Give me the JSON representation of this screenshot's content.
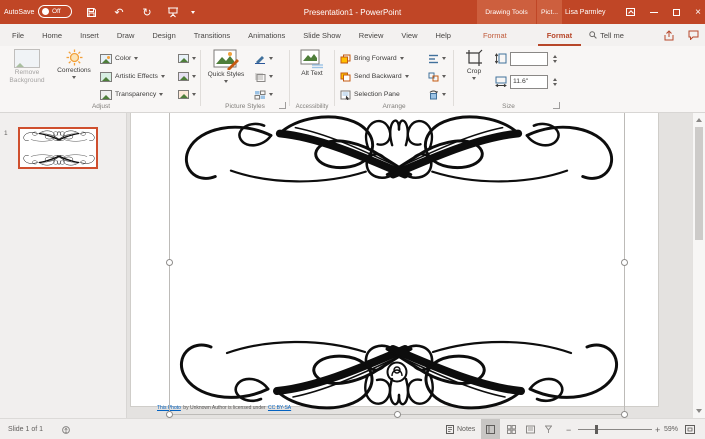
{
  "titlebar": {
    "autosave_label": "AutoSave",
    "autosave_state": "Off",
    "title": "Presentation1 - PowerPoint",
    "contextual_tool_1": "Drawing Tools",
    "contextual_tool_2": "Pict...",
    "user_name": "Lisa Parmley"
  },
  "icons": {
    "undo": "↶",
    "redo": "↻",
    "close": "×",
    "minus": "−",
    "plus": "+"
  },
  "tabs": {
    "items": [
      "File",
      "Home",
      "Insert",
      "Draw",
      "Design",
      "Transitions",
      "Animations",
      "Slide Show",
      "Review",
      "View",
      "Help"
    ],
    "format_drawing": "Format",
    "format_picture": "Format",
    "tell_me": "Tell me"
  },
  "ribbon": {
    "adjust": {
      "label": "Adjust",
      "remove_background": "Remove Background",
      "corrections": "Corrections",
      "color": "Color",
      "artistic_effects": "Artistic Effects",
      "transparency": "Transparency"
    },
    "picture_styles": {
      "label": "Picture Styles",
      "quick_styles": "Quick Styles"
    },
    "accessibility": {
      "label": "Accessibility",
      "alt_text": "Alt Text"
    },
    "arrange": {
      "label": "Arrange",
      "bring_forward": "Bring Forward",
      "send_backward": "Send Backward",
      "selection_pane": "Selection Pane"
    },
    "size": {
      "label": "Size",
      "crop": "Crop",
      "height_value": "",
      "width_value": "11.6\""
    }
  },
  "slide_panel": {
    "slide_number": "1"
  },
  "slide": {
    "attribution_link_1": "This Photo",
    "attribution_text": " by Unknown Author is licensed under ",
    "attribution_link_2": "CC BY-SA"
  },
  "statusbar": {
    "slide_counter": "Slide 1 of 1",
    "notes_label": "Notes",
    "zoom_percent": "59%"
  }
}
